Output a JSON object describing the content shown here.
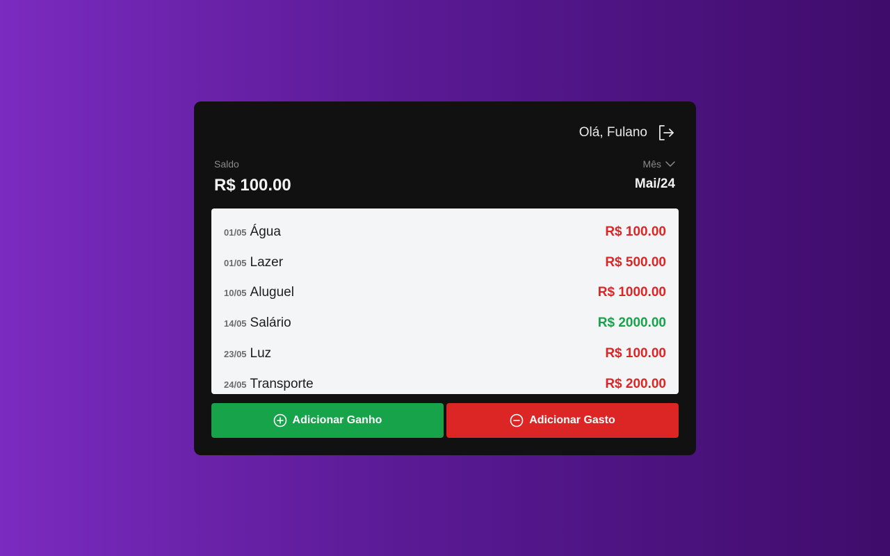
{
  "header": {
    "greeting": "Olá, Fulano",
    "logout_icon": "logout-icon"
  },
  "balance": {
    "label": "Saldo",
    "value": "R$ 100.00"
  },
  "month": {
    "label": "Mês",
    "value": "Mai/24"
  },
  "transactions": [
    {
      "date": "01/05",
      "description": "Água",
      "amount": "R$ 100.00",
      "type": "expense"
    },
    {
      "date": "01/05",
      "description": "Lazer",
      "amount": "R$ 500.00",
      "type": "expense"
    },
    {
      "date": "10/05",
      "description": "Aluguel",
      "amount": "R$ 1000.00",
      "type": "expense"
    },
    {
      "date": "14/05",
      "description": "Salário",
      "amount": "R$ 2000.00",
      "type": "income"
    },
    {
      "date": "23/05",
      "description": "Luz",
      "amount": "R$ 100.00",
      "type": "expense"
    },
    {
      "date": "24/05",
      "description": "Transporte",
      "amount": "R$ 200.00",
      "type": "expense"
    }
  ],
  "actions": {
    "add_income_label": "Adicionar Ganho",
    "add_expense_label": "Adicionar Gasto"
  },
  "colors": {
    "income": "#16a34a",
    "expense": "#dc2626",
    "card_background": "#111111"
  }
}
